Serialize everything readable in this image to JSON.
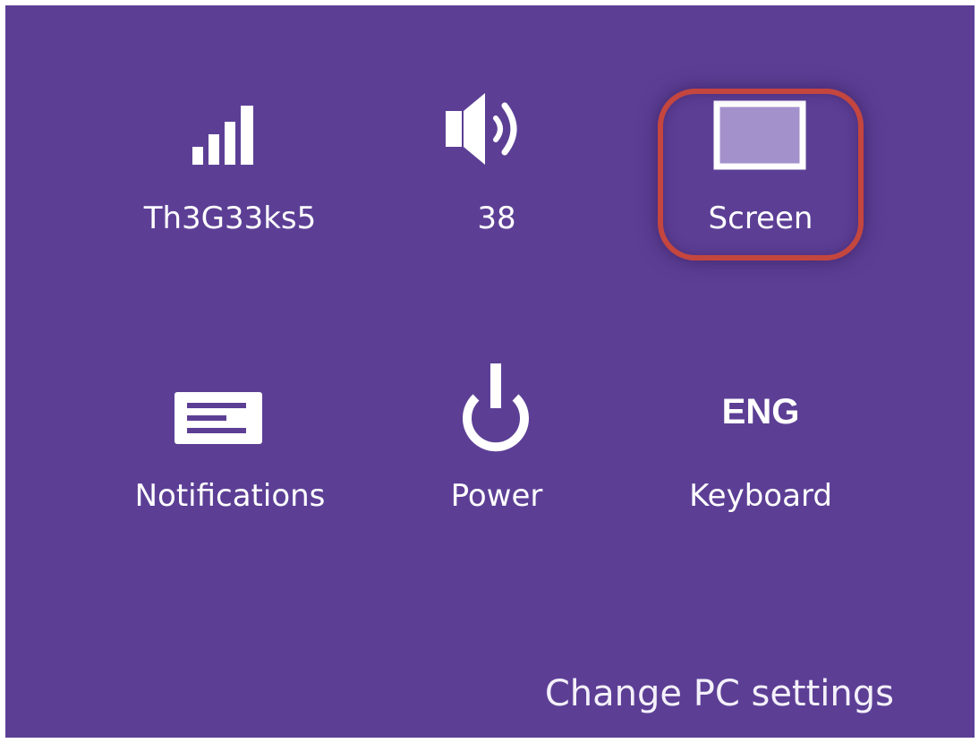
{
  "colors": {
    "background": "#5c3f95",
    "foreground": "#ffffff",
    "highlight_ring": "#c4463e",
    "screen_fill": "#a391cc"
  },
  "quick_settings": [
    {
      "id": "network",
      "icon": "signal-bars-icon",
      "label": "Th3G33ks5"
    },
    {
      "id": "volume",
      "icon": "speaker-icon",
      "label": "38"
    },
    {
      "id": "screen",
      "icon": "screen-icon",
      "label": "Screen",
      "highlighted": true
    },
    {
      "id": "notifications",
      "icon": "notifications-icon",
      "label": "Notifications"
    },
    {
      "id": "power",
      "icon": "power-icon",
      "label": "Power"
    },
    {
      "id": "keyboard",
      "icon": "language-indicator",
      "icon_text": "ENG",
      "label": "Keyboard"
    }
  ],
  "footer": {
    "change_pc_settings": "Change PC settings"
  }
}
